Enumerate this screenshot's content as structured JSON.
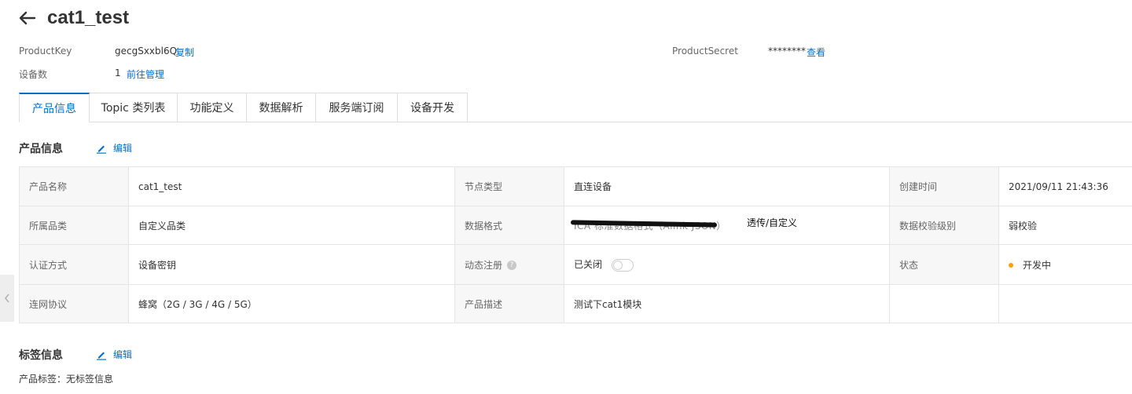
{
  "header": {
    "title": "cat1_test"
  },
  "meta": {
    "product_key_label": "ProductKey",
    "product_key_value": "gecgSxxbl6Q",
    "copy_label": "复制",
    "device_count_label": "设备数",
    "device_count_value": "1",
    "manage_label": "前往管理",
    "product_secret_label": "ProductSecret",
    "product_secret_value": "********",
    "view_label": "查看"
  },
  "tabs": [
    {
      "label": "产品信息",
      "active": true
    },
    {
      "label": "Topic 类列表"
    },
    {
      "label": "功能定义"
    },
    {
      "label": "数据解析"
    },
    {
      "label": "服务端订阅"
    },
    {
      "label": "设备开发"
    }
  ],
  "product_info": {
    "title": "产品信息",
    "edit_label": "编辑",
    "rows": [
      [
        "产品名称",
        "cat1_test",
        "节点类型",
        "直连设备",
        "创建时间",
        "2021/09/11 21:43:36"
      ],
      [
        "所属品类",
        "自定义品类",
        "数据格式",
        "ICA 标准数据格式（Alink JSON）",
        "数据校验级别",
        "弱校验"
      ],
      [
        "认证方式",
        "设备密钥",
        "动态注册",
        "已关闭",
        "状态",
        "开发中"
      ],
      [
        "连网协议",
        "蜂窝（2G / 3G / 4G / 5G）",
        "产品描述",
        "测试下cat1模块",
        "",
        ""
      ]
    ],
    "annotation": "透传/自定义"
  },
  "tag_info": {
    "title": "标签信息",
    "edit_label": "编辑",
    "product_tag_label": "产品标签：",
    "product_tag_value": "无标签信息"
  },
  "colors": {
    "accent": "#0070cc",
    "status_dev": "#ffa003"
  }
}
